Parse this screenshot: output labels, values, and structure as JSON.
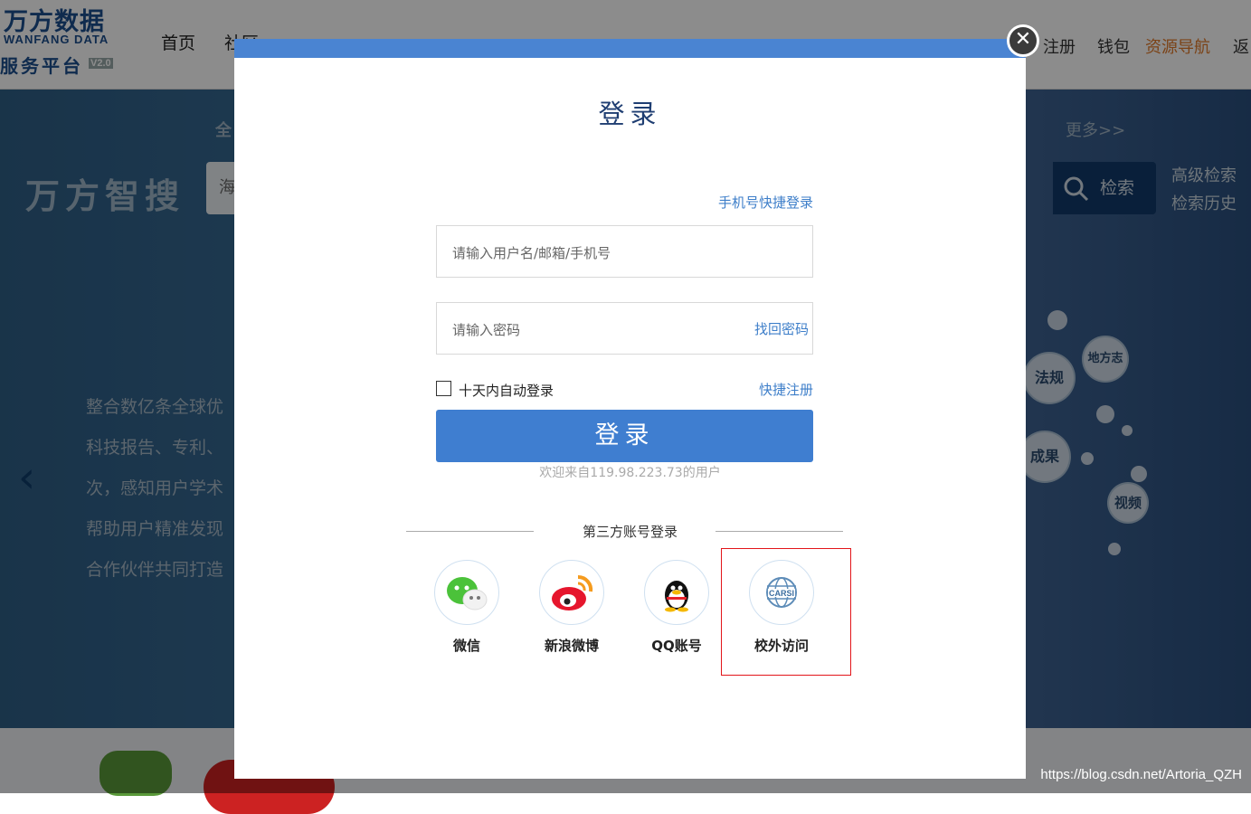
{
  "background": {
    "logo": {
      "line1": "万方数据",
      "line2": "WANFANG DATA",
      "line3": "服务平台",
      "version": "V2.0"
    },
    "nav": [
      "首页",
      "社区"
    ],
    "right_nav": [
      "注册",
      "钱包",
      "资源导航",
      "返"
    ],
    "hero": {
      "title": "万方智搜",
      "search_prefix": "海",
      "search_button": "检索",
      "advanced_search": "高级检索",
      "search_history": "检索历史",
      "category_first": "全",
      "category_more": "更多>>",
      "description_lines": [
        "整合数亿条全球优",
        "科技报告、专利、",
        "次，感知用户学术",
        "帮助用户精准发现",
        "合作伙伴共同打造"
      ],
      "bubbles": [
        "法规",
        "地方志",
        "成果",
        "视频"
      ]
    },
    "watermark": "https://blog.csdn.net/Artoria_QZH"
  },
  "modal": {
    "title": "登录",
    "phone_login_link": "手机号快捷登录",
    "username_placeholder": "请输入用户名/邮箱/手机号",
    "password_placeholder": "请输入密码",
    "forgot_password": "找回密码",
    "remember_label": "十天内自动登录",
    "quick_register": "快捷注册",
    "login_button": "登录",
    "welcome": "欢迎来自119.98.223.73的用户",
    "third_party_title": "第三方账号登录",
    "third_party": [
      {
        "label": "微信",
        "icon": "wechat-icon"
      },
      {
        "label": "新浪微博",
        "icon": "weibo-icon"
      },
      {
        "label": "QQ账号",
        "icon": "qq-icon"
      },
      {
        "label": "校外访问",
        "icon": "carsi-icon"
      }
    ]
  },
  "colors": {
    "accent": "#3f7ed0",
    "title": "#1f3e72",
    "link": "#3d7ec9",
    "highlight": "#e2151a",
    "resource_nav": "#e07a2a"
  }
}
